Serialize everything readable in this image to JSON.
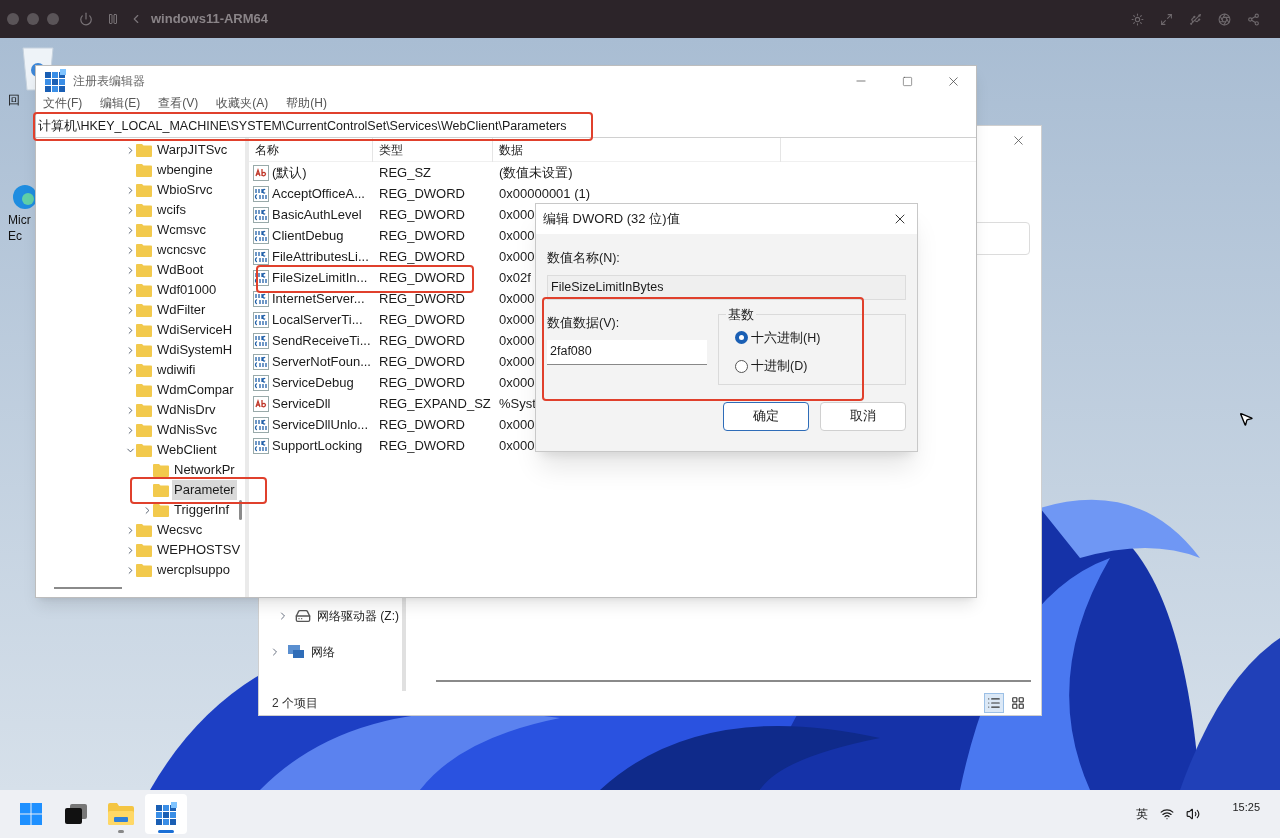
{
  "host_window": {
    "title": "windows11-ARM64"
  },
  "desktop_icons": [
    {
      "kind": "recycle",
      "lines": [
        "回"
      ]
    },
    {
      "kind": "browser",
      "lines": [
        "Micr",
        "Ec"
      ]
    }
  ],
  "explorer": {
    "nav_items": [
      {
        "kind": "drive",
        "label": "网络驱动器 (Z:)"
      },
      {
        "kind": "network",
        "label": "网络"
      }
    ],
    "status": "2 个项目",
    "views": [
      {
        "kind": "details",
        "selected": true
      },
      {
        "kind": "tiles",
        "selected": false
      }
    ]
  },
  "regedit": {
    "title": "注册表编辑器",
    "menu": [
      "文件(F)",
      "编辑(E)",
      "查看(V)",
      "收藏夹(A)",
      "帮助(H)"
    ],
    "address": "计算机\\HKEY_LOCAL_MACHINE\\SYSTEM\\CurrentControlSet\\Services\\WebClient\\Parameters",
    "tree": [
      {
        "label": "WarpJITSvc",
        "expanded": false,
        "selected": false
      },
      {
        "label": "wbengine",
        "selected": false
      },
      {
        "label": "WbioSrvc",
        "expanded": false,
        "selected": false
      },
      {
        "label": "wcifs",
        "expanded": false,
        "selected": false
      },
      {
        "label": "Wcmsvc",
        "expanded": false,
        "selected": false
      },
      {
        "label": "wcncsvc",
        "expanded": false,
        "selected": false
      },
      {
        "label": "WdBoot",
        "expanded": false,
        "selected": false
      },
      {
        "label": "Wdf01000",
        "expanded": false,
        "selected": false
      },
      {
        "label": "WdFilter",
        "expanded": false,
        "selected": false
      },
      {
        "label": "WdiServiceH",
        "expanded": false,
        "selected": false
      },
      {
        "label": "WdiSystemH",
        "expanded": false,
        "selected": false
      },
      {
        "label": "wdiwifi",
        "expanded": false,
        "selected": false
      },
      {
        "label": "WdmCompar",
        "selected": false
      },
      {
        "label": "WdNisDrv",
        "expanded": false,
        "selected": false
      },
      {
        "label": "WdNisSvc",
        "expanded": false,
        "selected": false
      },
      {
        "label": "WebClient",
        "expanded": true,
        "selected": false,
        "children": [
          {
            "label": "NetworkPr",
            "selected": false
          },
          {
            "label": "Parameter",
            "selected": true
          },
          {
            "label": "TriggerInf",
            "expanded": false,
            "selected": false
          }
        ]
      },
      {
        "label": "Wecsvc",
        "expanded": false,
        "selected": false
      },
      {
        "label": "WEPHOSTSV",
        "expanded": false,
        "selected": false
      },
      {
        "label": "wercplsuppo",
        "expanded": false,
        "selected": false
      }
    ],
    "columns": [
      "名称",
      "类型",
      "数据"
    ],
    "values": [
      {
        "kind": "string",
        "name": "(默认)",
        "type": "REG_SZ",
        "data": "(数值未设置)"
      },
      {
        "kind": "binary",
        "name": "AcceptOfficeA...",
        "type": "REG_DWORD",
        "data": "0x00000001 (1)"
      },
      {
        "kind": "binary",
        "name": "BasicAuthLevel",
        "type": "REG_DWORD",
        "data": "0x000"
      },
      {
        "kind": "binary",
        "name": "ClientDebug",
        "type": "REG_DWORD",
        "data": "0x000"
      },
      {
        "kind": "binary",
        "name": "FileAttributesLi...",
        "type": "REG_DWORD",
        "data": "0x000"
      },
      {
        "kind": "binary",
        "name": "FileSizeLimitIn...",
        "type": "REG_DWORD",
        "data": "0x02f"
      },
      {
        "kind": "binary",
        "name": "InternetServer...",
        "type": "REG_DWORD",
        "data": "0x000"
      },
      {
        "kind": "binary",
        "name": "LocalServerTi...",
        "type": "REG_DWORD",
        "data": "0x000"
      },
      {
        "kind": "binary",
        "name": "SendReceiveTi...",
        "type": "REG_DWORD",
        "data": "0x000"
      },
      {
        "kind": "binary",
        "name": "ServerNotFoun...",
        "type": "REG_DWORD",
        "data": "0x000"
      },
      {
        "kind": "binary",
        "name": "ServiceDebug",
        "type": "REG_DWORD",
        "data": "0x000"
      },
      {
        "kind": "string",
        "name": "ServiceDll",
        "type": "REG_EXPAND_SZ",
        "data": "%Syst"
      },
      {
        "kind": "binary",
        "name": "ServiceDllUnlo...",
        "type": "REG_DWORD",
        "data": "0x000"
      },
      {
        "kind": "binary",
        "name": "SupportLocking",
        "type": "REG_DWORD",
        "data": "0x000"
      }
    ]
  },
  "dialog": {
    "title": "编辑 DWORD (32 位)值",
    "name_label": "数值名称(N):",
    "name_value": "FileSizeLimitInBytes",
    "data_label": "数值数据(V):",
    "data_value": "2faf080",
    "base_label": "基数",
    "bases": [
      {
        "label": "十六进制(H)",
        "selected": true
      },
      {
        "label": "十进制(D)",
        "selected": false
      }
    ],
    "buttons": [
      {
        "label": "确定",
        "default": true
      },
      {
        "label": "取消",
        "default": false
      }
    ]
  },
  "taskbar": {
    "apps": [
      {
        "kind": "start",
        "active": false
      },
      {
        "kind": "taskview",
        "active": false
      },
      {
        "kind": "explorer",
        "active": false,
        "running": true
      },
      {
        "kind": "regedit",
        "active": true,
        "running": true
      }
    ],
    "ime": "英",
    "time": "15:25"
  }
}
